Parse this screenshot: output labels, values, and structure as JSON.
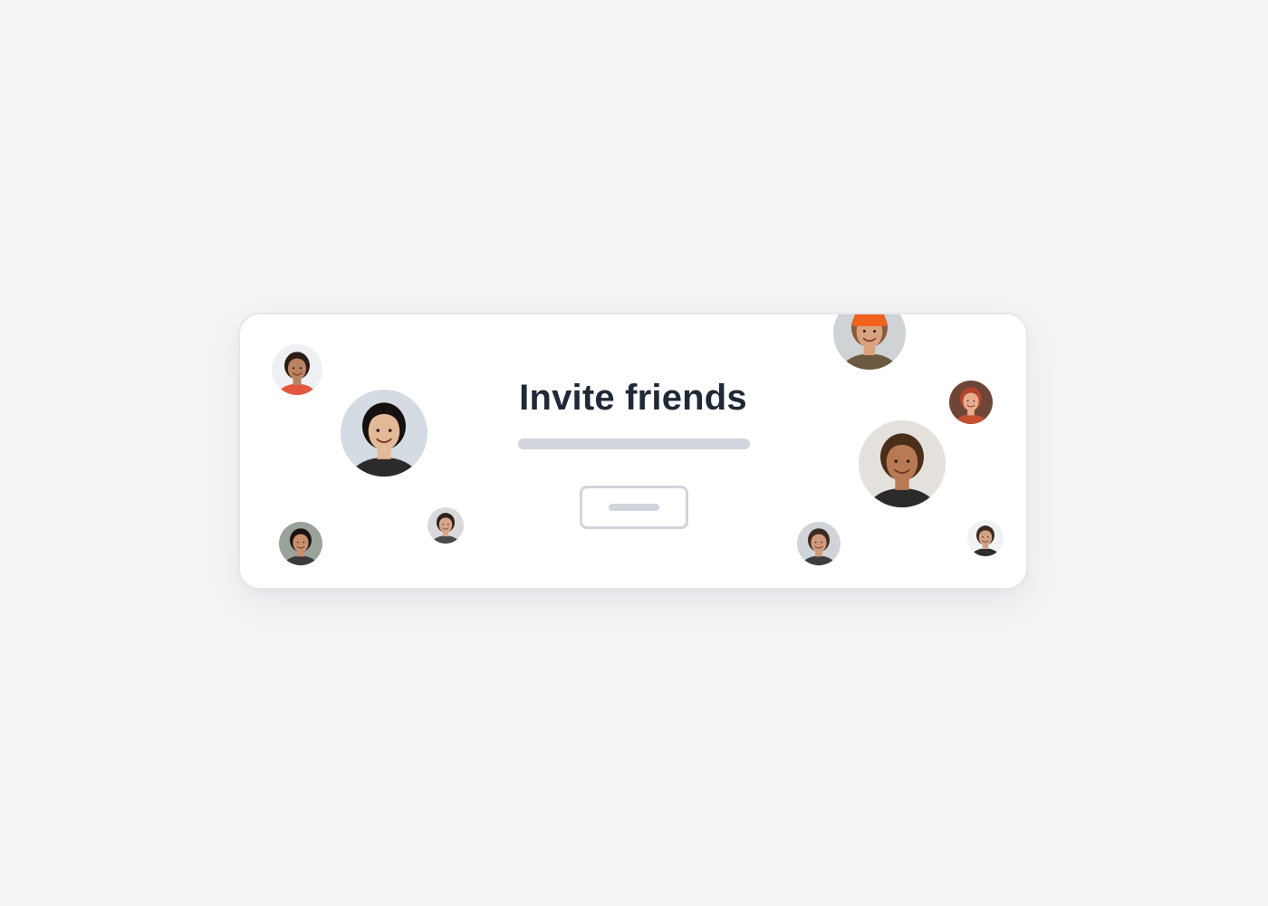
{
  "card": {
    "title": "Invite friends"
  },
  "avatars": [
    {
      "name": "avatar-curly-hair-orange-shirt",
      "bg": "#eef0f3",
      "skin": "#b98260",
      "hair": "#2a1d17",
      "shirt": "#e2583e"
    },
    {
      "name": "avatar-woman-large-left",
      "bg": "#d5dbe2",
      "skin": "#e4b998",
      "hair": "#15110f",
      "shirt": "#2b2b2b"
    },
    {
      "name": "avatar-woman-bottom-left",
      "bg": "#9aa39a",
      "skin": "#c98e6c",
      "hair": "#1b1411",
      "shirt": "#3a3a3a"
    },
    {
      "name": "avatar-woman-small-center-left",
      "bg": "#d9d9d9",
      "skin": "#d9a78a",
      "hair": "#2c211c",
      "shirt": "#4a4a4a"
    },
    {
      "name": "avatar-orange-beanie",
      "bg": "#cfd3d6",
      "skin": "#d8a27f",
      "hair": "#8a5a3a",
      "shirt": "#6b5a3f",
      "hat": "#f0621d"
    },
    {
      "name": "avatar-red-hair-woman",
      "bg": "#6e4638",
      "skin": "#e6ad8f",
      "hair": "#b4452c",
      "shirt": "#c45032"
    },
    {
      "name": "avatar-man-dreadlocks",
      "bg": "#e4e1dc",
      "skin": "#b77a55",
      "hair": "#4a2e1a",
      "shirt": "#2b2b2b"
    },
    {
      "name": "avatar-man-glasses",
      "bg": "#d0d4d8",
      "skin": "#cf9a7b",
      "hair": "#3b2a21",
      "shirt": "#3d3d3d"
    },
    {
      "name": "avatar-man-small-right",
      "bg": "#f1f2f3",
      "skin": "#d1a286",
      "hair": "#3a2a22",
      "shirt": "#2e2e2e"
    }
  ]
}
